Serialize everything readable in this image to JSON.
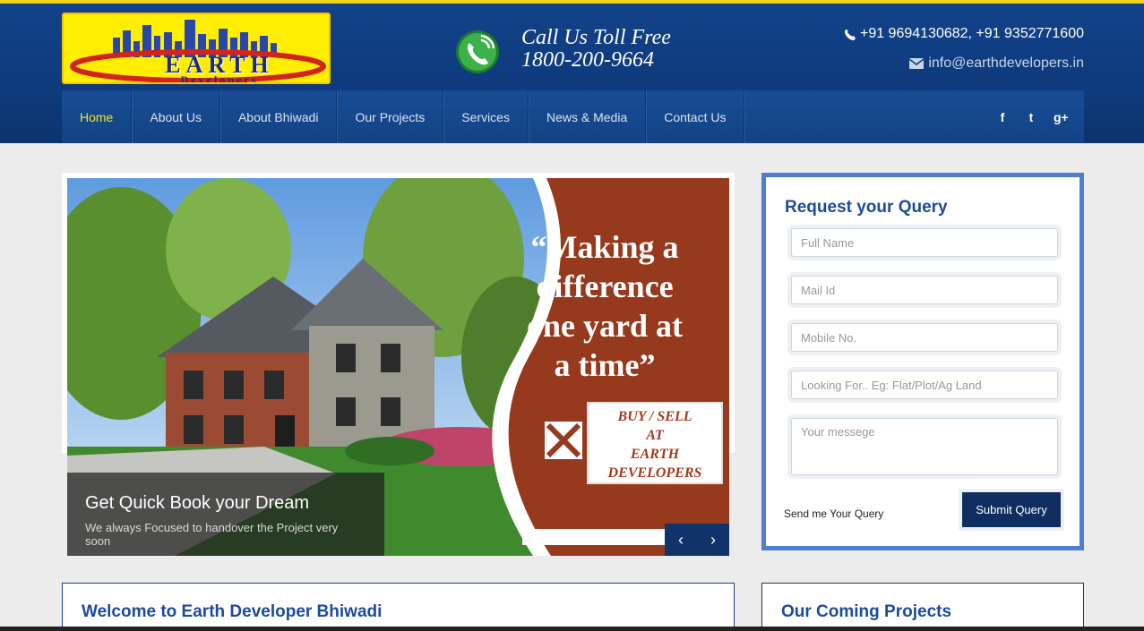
{
  "header": {
    "logo": {
      "title": "EARTH",
      "subtitle": "Developers"
    },
    "toll_free": {
      "label": "Call Us Toll Free",
      "number": "1800-200-9664"
    },
    "phones": "+91 9694130682, +91 9352771600",
    "email": "info@earthdevelopers.in"
  },
  "nav": {
    "items": [
      "Home",
      "About Us",
      "About Bhiwadi",
      "Our Projects",
      "Services",
      "News & Media",
      "Contact Us"
    ],
    "active": "Home",
    "social": [
      "f",
      "t",
      "g+"
    ]
  },
  "slider": {
    "quote": "“Making a difference one yard at a time”",
    "ad_lines": [
      "BUY / SELL",
      "AT",
      "EARTH",
      "DEVELOPERS"
    ],
    "caption_title": "Get Quick Book your Dream",
    "caption_subtitle": "We always Focused to handover the Project very soon",
    "prev_label": "‹",
    "next_label": "›"
  },
  "query_form": {
    "title": "Request your Query",
    "fields": [
      {
        "placeholder": "Full Name"
      },
      {
        "placeholder": "Mail Id"
      },
      {
        "placeholder": "Mobile No."
      },
      {
        "placeholder": "Looking For.. Eg: Flat/Plot/Ag Land"
      },
      {
        "placeholder": "Your messege"
      }
    ],
    "send_label": "Send me Your Query",
    "submit_label": "Submit Query"
  },
  "sections": {
    "welcome_title": "Welcome to Earth Developer Bhiwadi",
    "projects_title": "Our Coming Projects"
  },
  "colors": {
    "header_blue": "#0f3a7c",
    "accent_yellow": "#f7e21c",
    "form_border": "#4f7dcf",
    "heading_blue": "#1c4b9c",
    "button_navy": "#0f2e60"
  }
}
